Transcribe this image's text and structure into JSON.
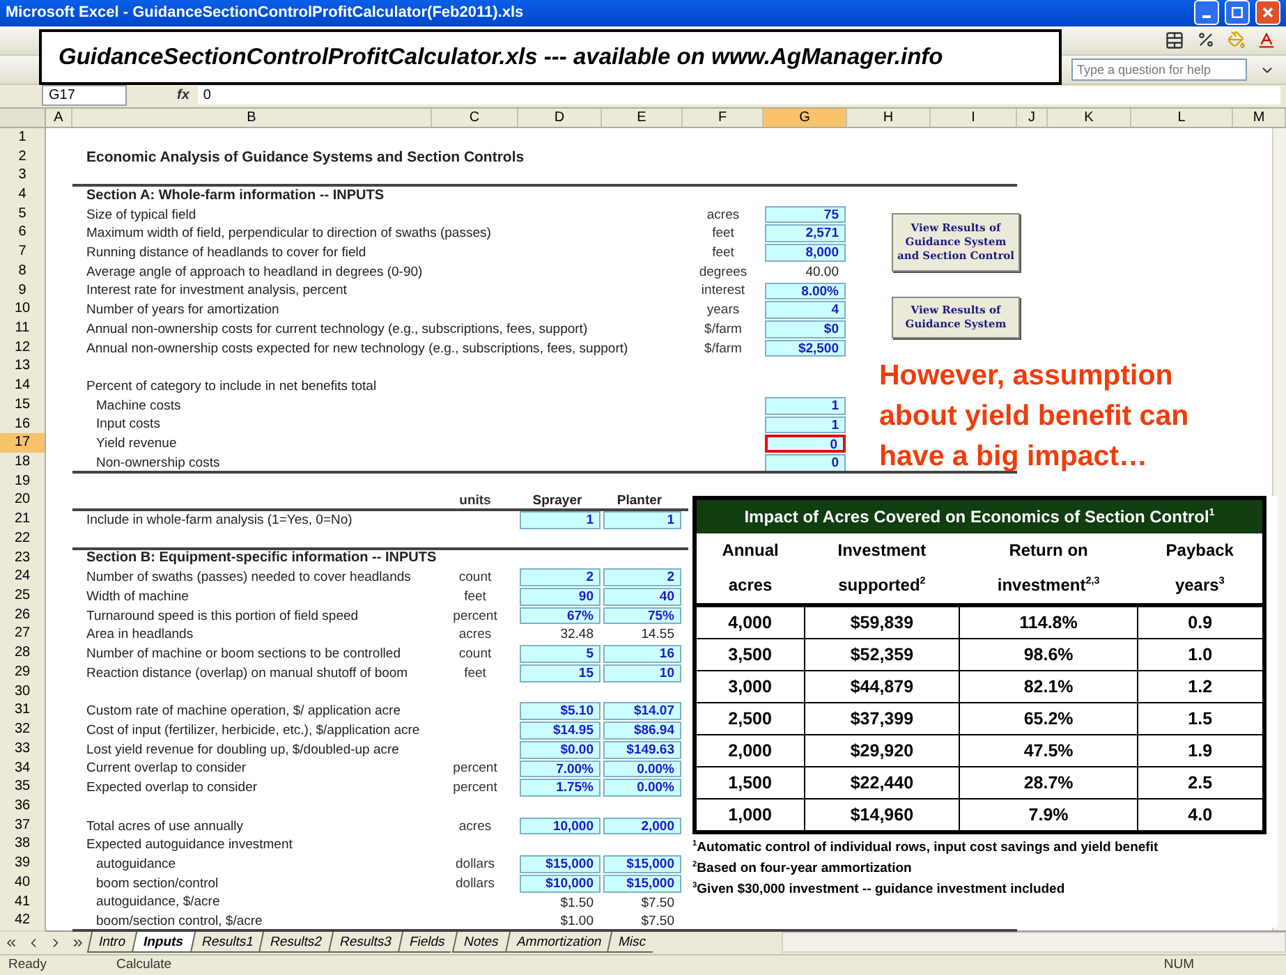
{
  "window": {
    "title": "Microsoft Excel - GuidanceSectionControlProfitCalculator(Feb2011).xls"
  },
  "banner": "GuidanceSectionControlProfitCalculator.xls --- available on www.AgManager.info",
  "help": {
    "placeholder": "Type a question for help"
  },
  "formula_bar": {
    "name_box": "G17",
    "function_label": "fx",
    "value": "0"
  },
  "columns": [
    {
      "label": "A",
      "selected": false
    },
    {
      "label": "B",
      "selected": false
    },
    {
      "label": "C",
      "selected": false
    },
    {
      "label": "D",
      "selected": false
    },
    {
      "label": "E",
      "selected": false
    },
    {
      "label": "F",
      "selected": false
    },
    {
      "label": "G",
      "selected": true
    },
    {
      "label": "H",
      "selected": false
    },
    {
      "label": "I",
      "selected": false
    },
    {
      "label": "J",
      "selected": false
    },
    {
      "label": "K",
      "selected": false
    },
    {
      "label": "L",
      "selected": false
    },
    {
      "label": "M",
      "selected": false
    }
  ],
  "rows": [
    {
      "number": "1",
      "selected": false,
      "kind": "blank",
      "rule_below": false
    },
    {
      "number": "2",
      "selected": false,
      "kind": "title",
      "label": "Economic Analysis of Guidance Systems and Section Controls",
      "rule_below": false
    },
    {
      "number": "3",
      "selected": false,
      "kind": "blank",
      "rule_below": true
    },
    {
      "number": "4",
      "selected": false,
      "kind": "section",
      "label": "Section A:  Whole-farm information -- INPUTS",
      "rule_below": false
    },
    {
      "number": "5",
      "selected": false,
      "kind": "item",
      "label": "Size of typical field",
      "unit": "acres",
      "values": [
        {
          "text": "75",
          "input": true,
          "selected": false
        }
      ],
      "rule_below": false
    },
    {
      "number": "6",
      "selected": false,
      "kind": "item",
      "label": "Maximum width of field, perpendicular to direction of swaths (passes)",
      "unit": "feet",
      "values": [
        {
          "text": "2,571",
          "input": true,
          "selected": false
        }
      ],
      "rule_below": false
    },
    {
      "number": "7",
      "selected": false,
      "kind": "item",
      "label": "Running distance of headlands to cover for field",
      "unit": "feet",
      "values": [
        {
          "text": "8,000",
          "input": true,
          "selected": false
        }
      ],
      "rule_below": false
    },
    {
      "number": "8",
      "selected": false,
      "kind": "item",
      "label": "Average angle of approach to headland in degrees (0-90)",
      "unit": "degrees",
      "values": [
        {
          "text": "40.00",
          "input": false,
          "selected": false
        }
      ],
      "rule_below": false
    },
    {
      "number": "9",
      "selected": false,
      "kind": "item",
      "label": "Interest rate for investment analysis, percent",
      "unit": "interest",
      "values": [
        {
          "text": "8.00%",
          "input": true,
          "selected": false
        }
      ],
      "rule_below": false
    },
    {
      "number": "10",
      "selected": false,
      "kind": "item",
      "label": "Number of years for amortization",
      "unit": "years",
      "values": [
        {
          "text": "4",
          "input": true,
          "selected": false
        }
      ],
      "rule_below": false
    },
    {
      "number": "11",
      "selected": false,
      "kind": "item",
      "label": "Annual non-ownership costs for current technology (e.g., subscriptions, fees, support)",
      "unit": "$/farm",
      "values": [
        {
          "text": "$0",
          "input": true,
          "selected": false
        }
      ],
      "rule_below": false
    },
    {
      "number": "12",
      "selected": false,
      "kind": "item",
      "label": "Annual non-ownership costs expected for new technology (e.g., subscriptions, fees, support)",
      "unit": "$/farm",
      "values": [
        {
          "text": "$2,500",
          "input": true,
          "selected": false
        }
      ],
      "rule_below": false
    },
    {
      "number": "13",
      "selected": false,
      "kind": "blank",
      "rule_below": false
    },
    {
      "number": "14",
      "selected": false,
      "kind": "item",
      "label": "Percent of category to include in net benefits total",
      "rule_below": false
    },
    {
      "number": "15",
      "selected": false,
      "kind": "sub",
      "label": "Machine costs",
      "values": [
        {
          "text": "1",
          "input": true,
          "selected": false
        }
      ],
      "rule_below": false
    },
    {
      "number": "16",
      "selected": false,
      "kind": "sub",
      "label": "Input costs",
      "values": [
        {
          "text": "1",
          "input": true,
          "selected": false
        }
      ],
      "rule_below": false
    },
    {
      "number": "17",
      "selected": true,
      "kind": "sub",
      "label": "Yield revenue",
      "values": [
        {
          "text": "0",
          "input": true,
          "selected": true
        }
      ],
      "rule_below": false
    },
    {
      "number": "18",
      "selected": false,
      "kind": "sub",
      "label": "Non-ownership costs",
      "values": [
        {
          "text": "0",
          "input": true,
          "selected": false
        }
      ],
      "rule_below": true
    },
    {
      "number": "19",
      "selected": false,
      "kind": "blank",
      "rule_below": false
    },
    {
      "number": "20",
      "selected": false,
      "kind": "header",
      "unit": "units",
      "values": [
        {
          "text": "Sprayer",
          "input": false,
          "selected": false
        },
        {
          "text": "Planter",
          "input": false,
          "selected": false
        }
      ],
      "rule_below": true
    },
    {
      "number": "21",
      "selected": false,
      "kind": "item",
      "label": "Include in whole-farm analysis (1=Yes, 0=No)",
      "values": [
        {
          "text": "1",
          "input": true,
          "selected": false
        },
        {
          "text": "1",
          "input": true,
          "selected": false
        }
      ],
      "rule_below": false
    },
    {
      "number": "22",
      "selected": false,
      "kind": "blank",
      "rule_below": true
    },
    {
      "number": "23",
      "selected": false,
      "kind": "section",
      "label": "Section B:  Equipment-specific information -- INPUTS",
      "rule_below": false
    },
    {
      "number": "24",
      "selected": false,
      "kind": "item",
      "label": "Number of swaths (passes) needed to cover headlands",
      "unit": "count",
      "values": [
        {
          "text": "2",
          "input": true,
          "selected": false
        },
        {
          "text": "2",
          "input": true,
          "selected": false
        }
      ],
      "rule_below": false
    },
    {
      "number": "25",
      "selected": false,
      "kind": "item",
      "label": "Width of machine",
      "unit": "feet",
      "values": [
        {
          "text": "90",
          "input": true,
          "selected": false
        },
        {
          "text": "40",
          "input": true,
          "selected": false
        }
      ],
      "rule_below": false
    },
    {
      "number": "26",
      "selected": false,
      "kind": "item",
      "label": "Turnaround speed is this portion of field speed",
      "unit": "percent",
      "values": [
        {
          "text": "67%",
          "input": true,
          "selected": false
        },
        {
          "text": "75%",
          "input": true,
          "selected": false
        }
      ],
      "rule_below": false
    },
    {
      "number": "27",
      "selected": false,
      "kind": "item",
      "label": "Area in headlands",
      "unit": "acres",
      "values": [
        {
          "text": "32.48",
          "input": false,
          "selected": false
        },
        {
          "text": "14.55",
          "input": false,
          "selected": false
        }
      ],
      "rule_below": false
    },
    {
      "number": "28",
      "selected": false,
      "kind": "item",
      "label": "Number of machine or boom sections to be controlled",
      "unit": "count",
      "values": [
        {
          "text": "5",
          "input": true,
          "selected": false
        },
        {
          "text": "16",
          "input": true,
          "selected": false
        }
      ],
      "rule_below": false
    },
    {
      "number": "29",
      "selected": false,
      "kind": "item",
      "label": "Reaction distance (overlap) on manual shutoff of boom",
      "unit": "feet",
      "values": [
        {
          "text": "15",
          "input": true,
          "selected": false
        },
        {
          "text": "10",
          "input": true,
          "selected": false
        }
      ],
      "rule_below": false
    },
    {
      "number": "30",
      "selected": false,
      "kind": "blank",
      "rule_below": false
    },
    {
      "number": "31",
      "selected": false,
      "kind": "item",
      "label": "Custom rate of machine operation, $/ application acre",
      "values": [
        {
          "text": "$5.10",
          "input": true,
          "selected": false
        },
        {
          "text": "$14.07",
          "input": true,
          "selected": false
        }
      ],
      "rule_below": false
    },
    {
      "number": "32",
      "selected": false,
      "kind": "item",
      "label": "Cost of input (fertilizer, herbicide, etc.), $/application acre",
      "values": [
        {
          "text": "$14.95",
          "input": true,
          "selected": false
        },
        {
          "text": "$86.94",
          "input": true,
          "selected": false
        }
      ],
      "rule_below": false
    },
    {
      "number": "33",
      "selected": false,
      "kind": "item",
      "label": "Lost yield revenue for doubling up, $/doubled-up acre",
      "values": [
        {
          "text": "$0.00",
          "input": true,
          "selected": false
        },
        {
          "text": "$149.63",
          "input": true,
          "selected": false
        }
      ],
      "rule_below": false
    },
    {
      "number": "34",
      "selected": false,
      "kind": "item",
      "label": "Current overlap to consider",
      "unit": "percent",
      "values": [
        {
          "text": "7.00%",
          "input": true,
          "selected": false
        },
        {
          "text": "0.00%",
          "input": true,
          "selected": false
        }
      ],
      "rule_below": false
    },
    {
      "number": "35",
      "selected": false,
      "kind": "item",
      "label": "Expected overlap to consider",
      "unit": "percent",
      "values": [
        {
          "text": "1.75%",
          "input": true,
          "selected": false
        },
        {
          "text": "0.00%",
          "input": true,
          "selected": false
        }
      ],
      "rule_below": false
    },
    {
      "number": "36",
      "selected": false,
      "kind": "blank",
      "rule_below": false
    },
    {
      "number": "37",
      "selected": false,
      "kind": "item",
      "label": "Total acres of use annually",
      "unit": "acres",
      "values": [
        {
          "text": "10,000",
          "input": true,
          "selected": false
        },
        {
          "text": "2,000",
          "input": true,
          "selected": false
        }
      ],
      "rule_below": false
    },
    {
      "number": "38",
      "selected": false,
      "kind": "item",
      "label": "Expected autoguidance investment",
      "rule_below": false
    },
    {
      "number": "39",
      "selected": false,
      "kind": "sub",
      "label": "autoguidance",
      "unit": "dollars",
      "values": [
        {
          "text": "$15,000",
          "input": true,
          "selected": false
        },
        {
          "text": "$15,000",
          "input": true,
          "selected": false
        }
      ],
      "rule_below": false
    },
    {
      "number": "40",
      "selected": false,
      "kind": "sub",
      "label": "boom section/control",
      "unit": "dollars",
      "values": [
        {
          "text": "$10,000",
          "input": true,
          "selected": false
        },
        {
          "text": "$15,000",
          "input": true,
          "selected": false
        }
      ],
      "rule_below": false
    },
    {
      "number": "41",
      "selected": false,
      "kind": "sub",
      "label": "autoguidance, $/acre",
      "values": [
        {
          "text": "$1.50",
          "input": false,
          "selected": false
        },
        {
          "text": "$7.50",
          "input": false,
          "selected": false
        }
      ],
      "rule_below": false
    },
    {
      "number": "42",
      "selected": false,
      "kind": "sub",
      "label": "boom/section control, $/acre",
      "values": [
        {
          "text": "$1.00",
          "input": false,
          "selected": false
        },
        {
          "text": "$7.50",
          "input": false,
          "selected": false
        }
      ],
      "rule_below": true
    }
  ],
  "buttons": [
    "View Results of Guidance System and Section Control",
    "View Results of Guidance System"
  ],
  "callout": "However, assumption about yield benefit can have a big impact…",
  "impact_table": {
    "title": "Impact of Acres Covered on Economics of Section Control$^{1}$",
    "header_rows": [
      [
        "Annual",
        "Investment",
        "Return on",
        "Payback"
      ],
      [
        "acres",
        "supported$^{2}$",
        "investment$^{2,3}$",
        "years$^{3}$"
      ]
    ],
    "rows": [
      [
        "4,000",
        "$59,839",
        "114.8%",
        "0.9"
      ],
      [
        "3,500",
        "$52,359",
        "98.6%",
        "1.0"
      ],
      [
        "3,000",
        "$44,879",
        "82.1%",
        "1.2"
      ],
      [
        "2,500",
        "$37,399",
        "65.2%",
        "1.5"
      ],
      [
        "2,000",
        "$29,920",
        "47.5%",
        "1.9"
      ],
      [
        "1,500",
        "$22,440",
        "28.7%",
        "2.5"
      ],
      [
        "1,000",
        "$14,960",
        "7.9%",
        "4.0"
      ]
    ],
    "footnotes": [
      "$^{1}$Automatic control of individual rows, input cost savings and yield benefit",
      "$^{2}$Based on four-year ammortization",
      "$^{3}$Given $30,000 investment -- guidance investment included"
    ]
  },
  "sheet_tabs": [
    {
      "label": "Intro",
      "selected": false
    },
    {
      "label": "Inputs",
      "selected": true
    },
    {
      "label": "Results1",
      "selected": false
    },
    {
      "label": "Results2",
      "selected": false
    },
    {
      "label": "Results3",
      "selected": false
    },
    {
      "label": "Fields",
      "selected": false
    },
    {
      "label": "Notes",
      "selected": false
    },
    {
      "label": "Ammortization",
      "selected": false
    },
    {
      "label": "Misc",
      "selected": false
    }
  ],
  "status_bar": {
    "left": "Ready",
    "mode": "Calculate",
    "indicator": "NUM"
  }
}
